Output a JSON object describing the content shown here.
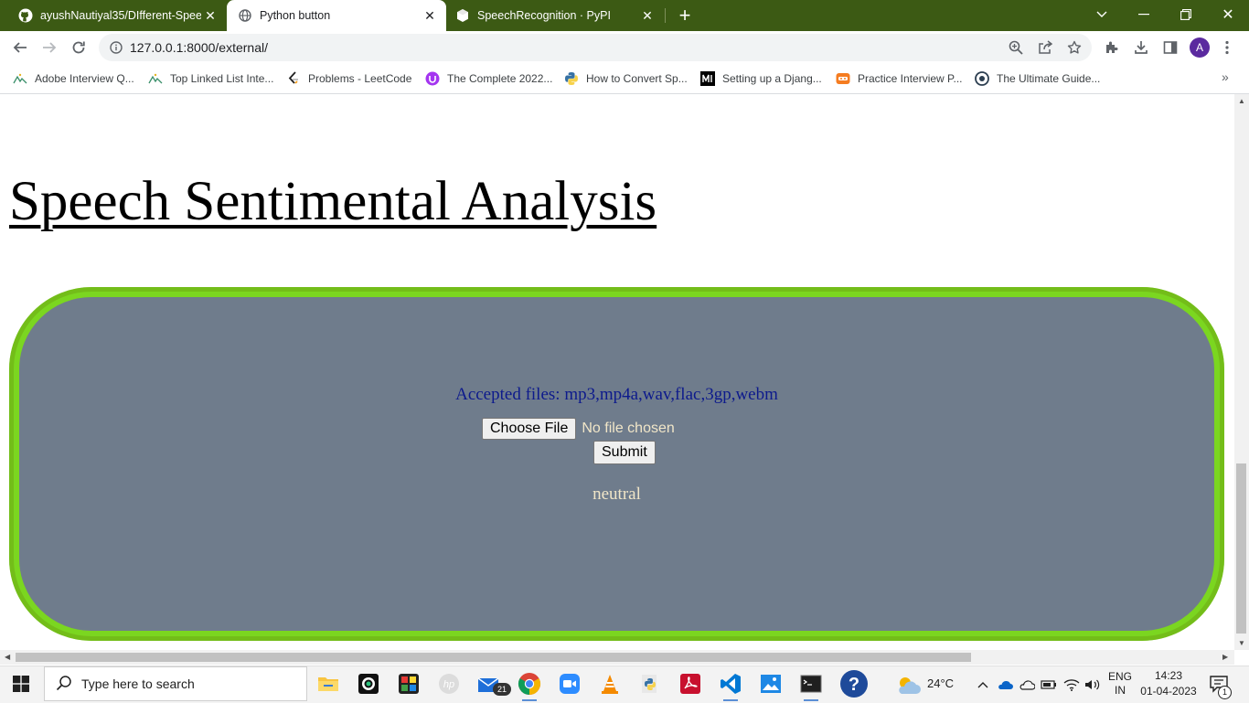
{
  "browser": {
    "tabs": [
      {
        "title": "ayushNautiyal35/DIfferent-Speec",
        "icon": "github-icon",
        "active": false
      },
      {
        "title": "Python button",
        "icon": "globe-icon",
        "active": true
      },
      {
        "title": "SpeechRecognition · PyPI",
        "icon": "pypi-icon",
        "active": false
      }
    ],
    "url": "127.0.0.1:8000/external/",
    "profile_initial": "A",
    "bookmarks": [
      {
        "label": "Adobe Interview Q...",
        "icon": "bookmark-icon"
      },
      {
        "label": "Top Linked List Inte...",
        "icon": "bookmark-icon"
      },
      {
        "label": "Problems - LeetCode",
        "icon": "leetcode-icon"
      },
      {
        "label": "The Complete 2022...",
        "icon": "udemy-icon"
      },
      {
        "label": "How to Convert Sp...",
        "icon": "python-icon"
      },
      {
        "label": "Setting up a Djang...",
        "icon": "medium-icon"
      },
      {
        "label": "Practice Interview P...",
        "icon": "codingninjas-icon"
      },
      {
        "label": "The Ultimate Guide...",
        "icon": "globe-icon"
      }
    ]
  },
  "page": {
    "heading": "Speech Sentimental Analysis",
    "accepted_files": "Accepted files: mp3,mp4a,wav,flac,3gp,webm",
    "choose_file_label": "Choose File",
    "no_file_text": "No file chosen",
    "submit_label": "Submit",
    "result": "neutral",
    "colors": {
      "panel_bg": "#6f7c8c",
      "panel_border": "#7bd620",
      "accepted_text": "#0d1a8c",
      "result_text": "#f1e6c8"
    }
  },
  "taskbar": {
    "search_placeholder": "Type here to search",
    "mail_badge": "21",
    "temperature": "24°C",
    "lang_line1": "ENG",
    "lang_line2": "IN",
    "time": "14:23",
    "date": "01-04-2023",
    "notification_count": "1"
  }
}
